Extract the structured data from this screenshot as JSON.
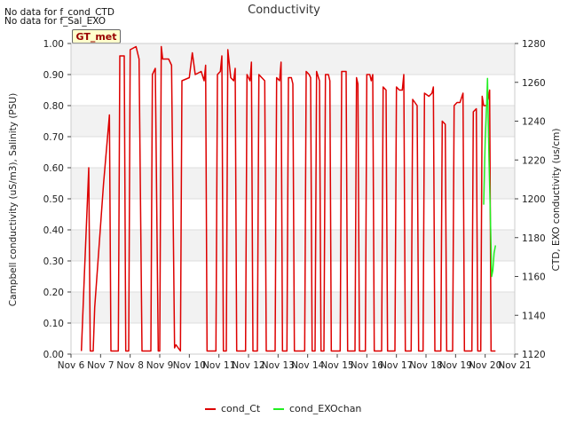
{
  "notes": [
    "No data for f_cond_CTD",
    "No data for f_Sal_EXO"
  ],
  "badge": "GT_met",
  "chart_data": {
    "type": "line",
    "title": "Conductivity",
    "ylabel_left": "Campbell conductivity (uS/m3), Salinity (PSU)",
    "ylabel_right": "CTD, EXO conductivity (us/cm)",
    "ylim_left": [
      0.0,
      1.0
    ],
    "ylim_right": [
      1120,
      1280
    ],
    "y_left_ticks": [
      0.0,
      0.1,
      0.2,
      0.3,
      0.4,
      0.5,
      0.6,
      0.7,
      0.8,
      0.9,
      1.0
    ],
    "y_left_tick_labels": [
      "0.00",
      "0.10",
      "0.20",
      "0.30",
      "0.40",
      "0.50",
      "0.60",
      "0.70",
      "0.80",
      "0.90",
      "1.00"
    ],
    "y_right_ticks": [
      1120,
      1140,
      1160,
      1180,
      1200,
      1220,
      1240,
      1260,
      1280
    ],
    "x_ticks": [
      6,
      7,
      8,
      9,
      10,
      11,
      12,
      13,
      14,
      15,
      16,
      17,
      18,
      19,
      20,
      21
    ],
    "x_tick_labels": [
      "Nov 6",
      "Nov 7",
      "Nov 8",
      "Nov 9",
      "Nov 10",
      "Nov 11",
      "Nov 12",
      "Nov 13",
      "Nov 14",
      "Nov 15",
      "Nov 16",
      "Nov 17",
      "Nov 18",
      "Nov 19",
      "Nov 20",
      "Nov 21"
    ],
    "xlim": [
      6,
      21
    ],
    "grid": true,
    "legend_position": "bottom-center",
    "series": [
      {
        "name": "cond_Ct",
        "axis": "left",
        "color": "#dd0000",
        "points": [
          [
            6.35,
            0.01
          ],
          [
            6.45,
            0.25
          ],
          [
            6.6,
            0.6
          ],
          [
            6.65,
            0.01
          ],
          [
            6.75,
            0.01
          ],
          [
            6.8,
            0.15
          ],
          [
            7.1,
            0.55
          ],
          [
            7.3,
            0.77
          ],
          [
            7.35,
            0.01
          ],
          [
            7.6,
            0.01
          ],
          [
            7.65,
            0.96
          ],
          [
            7.8,
            0.96
          ],
          [
            7.85,
            0.01
          ],
          [
            7.95,
            0.01
          ],
          [
            8.0,
            0.98
          ],
          [
            8.2,
            0.99
          ],
          [
            8.3,
            0.95
          ],
          [
            8.4,
            0.01
          ],
          [
            8.7,
            0.01
          ],
          [
            8.75,
            0.9
          ],
          [
            8.85,
            0.92
          ],
          [
            8.95,
            0.01
          ],
          [
            9.0,
            0.01
          ],
          [
            9.05,
            0.99
          ],
          [
            9.1,
            0.95
          ],
          [
            9.3,
            0.95
          ],
          [
            9.4,
            0.93
          ],
          [
            9.5,
            0.02
          ],
          [
            9.55,
            0.03
          ],
          [
            9.7,
            0.01
          ],
          [
            9.75,
            0.88
          ],
          [
            10.0,
            0.89
          ],
          [
            10.1,
            0.97
          ],
          [
            10.2,
            0.9
          ],
          [
            10.4,
            0.91
          ],
          [
            10.5,
            0.88
          ],
          [
            10.55,
            0.93
          ],
          [
            10.6,
            0.01
          ],
          [
            10.9,
            0.01
          ],
          [
            10.95,
            0.9
          ],
          [
            11.05,
            0.91
          ],
          [
            11.1,
            0.96
          ],
          [
            11.15,
            0.01
          ],
          [
            11.25,
            0.01
          ],
          [
            11.3,
            0.98
          ],
          [
            11.4,
            0.89
          ],
          [
            11.5,
            0.88
          ],
          [
            11.55,
            0.92
          ],
          [
            11.6,
            0.01
          ],
          [
            11.9,
            0.01
          ],
          [
            11.95,
            0.9
          ],
          [
            12.05,
            0.88
          ],
          [
            12.1,
            0.94
          ],
          [
            12.15,
            0.01
          ],
          [
            12.3,
            0.01
          ],
          [
            12.35,
            0.9
          ],
          [
            12.45,
            0.89
          ],
          [
            12.55,
            0.88
          ],
          [
            12.6,
            0.01
          ],
          [
            12.9,
            0.01
          ],
          [
            12.95,
            0.89
          ],
          [
            13.05,
            0.88
          ],
          [
            13.1,
            0.94
          ],
          [
            13.15,
            0.01
          ],
          [
            13.3,
            0.01
          ],
          [
            13.35,
            0.89
          ],
          [
            13.45,
            0.89
          ],
          [
            13.5,
            0.87
          ],
          [
            13.55,
            0.01
          ],
          [
            13.9,
            0.01
          ],
          [
            13.95,
            0.91
          ],
          [
            14.05,
            0.9
          ],
          [
            14.1,
            0.89
          ],
          [
            14.15,
            0.01
          ],
          [
            14.25,
            0.01
          ],
          [
            14.3,
            0.91
          ],
          [
            14.4,
            0.88
          ],
          [
            14.45,
            0.01
          ],
          [
            14.55,
            0.01
          ],
          [
            14.6,
            0.9
          ],
          [
            14.7,
            0.9
          ],
          [
            14.75,
            0.88
          ],
          [
            14.8,
            0.01
          ],
          [
            15.1,
            0.01
          ],
          [
            15.15,
            0.91
          ],
          [
            15.3,
            0.91
          ],
          [
            15.35,
            0.01
          ],
          [
            15.6,
            0.01
          ],
          [
            15.65,
            0.89
          ],
          [
            15.7,
            0.87
          ],
          [
            15.75,
            0.01
          ],
          [
            15.95,
            0.01
          ],
          [
            16.0,
            0.9
          ],
          [
            16.1,
            0.9
          ],
          [
            16.15,
            0.88
          ],
          [
            16.2,
            0.9
          ],
          [
            16.25,
            0.01
          ],
          [
            16.5,
            0.01
          ],
          [
            16.55,
            0.86
          ],
          [
            16.65,
            0.85
          ],
          [
            16.7,
            0.01
          ],
          [
            16.95,
            0.01
          ],
          [
            17.0,
            0.86
          ],
          [
            17.1,
            0.85
          ],
          [
            17.2,
            0.85
          ],
          [
            17.25,
            0.9
          ],
          [
            17.3,
            0.01
          ],
          [
            17.5,
            0.01
          ],
          [
            17.55,
            0.82
          ],
          [
            17.7,
            0.8
          ],
          [
            17.75,
            0.01
          ],
          [
            17.9,
            0.01
          ],
          [
            17.95,
            0.84
          ],
          [
            18.1,
            0.83
          ],
          [
            18.2,
            0.84
          ],
          [
            18.25,
            0.86
          ],
          [
            18.3,
            0.01
          ],
          [
            18.5,
            0.01
          ],
          [
            18.55,
            0.75
          ],
          [
            18.65,
            0.74
          ],
          [
            18.7,
            0.01
          ],
          [
            18.9,
            0.01
          ],
          [
            18.95,
            0.8
          ],
          [
            19.05,
            0.81
          ],
          [
            19.15,
            0.81
          ],
          [
            19.25,
            0.84
          ],
          [
            19.3,
            0.01
          ],
          [
            19.55,
            0.01
          ],
          [
            19.6,
            0.78
          ],
          [
            19.7,
            0.79
          ],
          [
            19.75,
            0.01
          ],
          [
            19.85,
            0.01
          ],
          [
            19.9,
            0.83
          ],
          [
            19.95,
            0.8
          ],
          [
            20.05,
            0.8
          ],
          [
            20.1,
            0.82
          ],
          [
            20.15,
            0.85
          ],
          [
            20.2,
            0.01
          ],
          [
            20.35,
            0.01
          ]
        ]
      },
      {
        "name": "cond_EXOchan",
        "axis": "right",
        "color": "#22ee22",
        "points": [
          [
            19.95,
            1197
          ],
          [
            20.0,
            1230
          ],
          [
            20.05,
            1248
          ],
          [
            20.08,
            1262
          ],
          [
            20.1,
            1244
          ],
          [
            20.13,
            1220
          ],
          [
            20.17,
            1196
          ],
          [
            20.22,
            1160
          ],
          [
            20.26,
            1163
          ],
          [
            20.3,
            1172
          ],
          [
            20.35,
            1176
          ]
        ]
      }
    ]
  }
}
